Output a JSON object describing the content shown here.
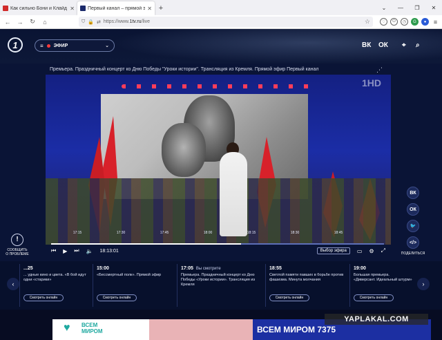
{
  "browser": {
    "tabs": [
      {
        "label": "Как сильно Бони и Клайд пол",
        "active": false,
        "favicon_color": "#d12b2b"
      },
      {
        "label": "Первый канал – прямой эфир",
        "active": true,
        "favicon_color": "#1b2a6b"
      }
    ],
    "new_tab": "+",
    "url_prefix": "https://www.",
    "url_domain": "1tv.ru",
    "url_path": "/live"
  },
  "site": {
    "logo_text": "1",
    "efir_label": "ЭФИР",
    "header_icons": [
      "vk-icon",
      "ok-icon",
      "location-icon",
      "search-icon"
    ],
    "vk_label": "ВК",
    "ok_label": "ОК"
  },
  "player": {
    "title": "Премьера. Праздничный концерт ко Дню Победы \"Уроки истории\". Трансляция из Кремля. Прямой эфир Первый канал",
    "hd_badge": "1HD",
    "timeline_ticks": [
      "17:15",
      "17:30",
      "17:45",
      "18:00",
      "18:15",
      "18:30",
      "18:45"
    ],
    "progress": 0.57,
    "current_time": "18:13:01",
    "quality_select": "Выбор эфира"
  },
  "report": {
    "label_line1": "СООБЩИТЬ",
    "label_line2": "О ПРОБЛЕМЕ"
  },
  "social": {
    "buttons": [
      "ВК",
      "ОК",
      "ТВ",
      "</>"
    ],
    "share_label": "ПОДЕЛИТЬСЯ"
  },
  "schedule": {
    "items": [
      {
        "time": "...25",
        "title": "... удные кино и цвета. «В бой идут одни «старики»",
        "now_label": "",
        "watch": "Смотреть онлайн"
      },
      {
        "time": "15:00",
        "title": "«Бессмертный полк». Прямой эфир",
        "now_label": "",
        "watch": "Смотреть онлайн"
      },
      {
        "time": "17:05",
        "title": "Премьера. Праздничный концерт ко Дню Победы «Уроки истории». Трансляция из Кремля",
        "now_label": "Вы смотрите",
        "watch": ""
      },
      {
        "time": "18:55",
        "title": "Светлой памяти павших в борьбе против фашизма. Минута молчания",
        "now_label": "",
        "watch": "Смотреть онлайн"
      },
      {
        "time": "19:00",
        "title": "Большая премьера. «Диверсант. Идеальный штурм»",
        "now_label": "",
        "watch": "Смотреть онлайн"
      }
    ]
  },
  "ad": {
    "brand_line1": "ВСЕМ",
    "brand_line2": "МИРОМ",
    "number": "ВСЕМ МИРОМ 7375"
  },
  "watermark": "YAPLAKAL.COM"
}
